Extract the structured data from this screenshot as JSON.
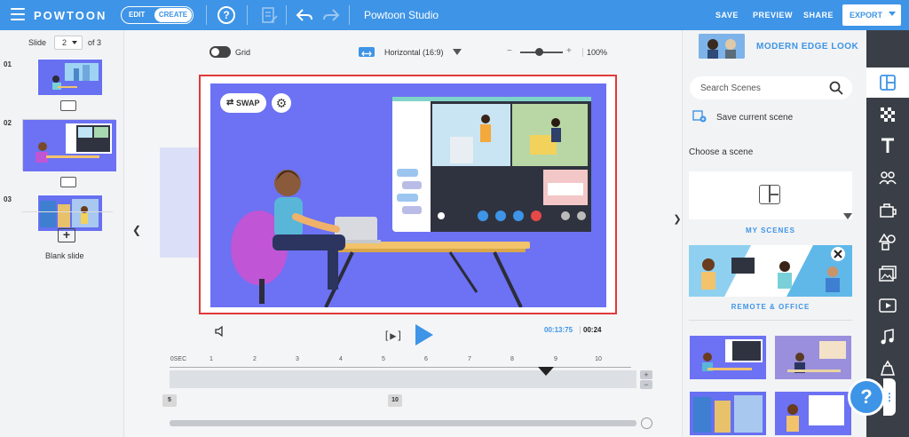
{
  "app": {
    "logo": "POWTOON",
    "title": "Powtoon Studio",
    "mode": {
      "edit_label": "EDIT",
      "create_label": "CREATE"
    },
    "help_label": "?",
    "actions": {
      "save": "SAVE",
      "preview": "PREVIEW",
      "share": "SHARE",
      "export": "EXPORT"
    }
  },
  "slides_panel": {
    "slide_label": "Slide",
    "current_slide": "2",
    "of_label": "of 3",
    "slides": [
      {
        "index": "01"
      },
      {
        "index": "02"
      },
      {
        "index": "03"
      }
    ],
    "blank_slide_label": "Blank slide"
  },
  "canvas_toolbar": {
    "grid_label": "Grid",
    "orientation_label": "Horizontal (16:9)",
    "zoom_minus": "−",
    "zoom_plus": "+",
    "zoom_value": "100%"
  },
  "stage": {
    "swap_label": "SWAP"
  },
  "playback": {
    "frame_play_label": "[▶]",
    "current_time": "00:13:75",
    "total_time": "00:24"
  },
  "timeline": {
    "ticks": [
      "0SEC",
      "1",
      "2",
      "3",
      "4",
      "5",
      "6",
      "7",
      "8",
      "9",
      "10"
    ],
    "zoom_in": "+",
    "zoom_out": "−",
    "markers": [
      "5",
      "10"
    ]
  },
  "scenes_panel": {
    "look_title": "MODERN EDGE LOOK",
    "search_placeholder": "Search Scenes",
    "save_current_scene": "Save current scene",
    "choose_label": "Choose a scene",
    "categories": [
      "MY SCENES",
      "REMOTE & OFFICE"
    ]
  },
  "colors": {
    "accent": "#3e94e6",
    "topbar": "#3e94e6",
    "stage_bg": "#6c72f3",
    "selection_border": "#e03a3a",
    "rail": "#3a3f47"
  },
  "icons": {
    "rail": [
      "layout-icon",
      "texture-icon",
      "text-icon",
      "characters-icon",
      "props-icon",
      "shapes-icon",
      "images-icon",
      "video-icon",
      "music-icon",
      "specials-icon"
    ]
  }
}
